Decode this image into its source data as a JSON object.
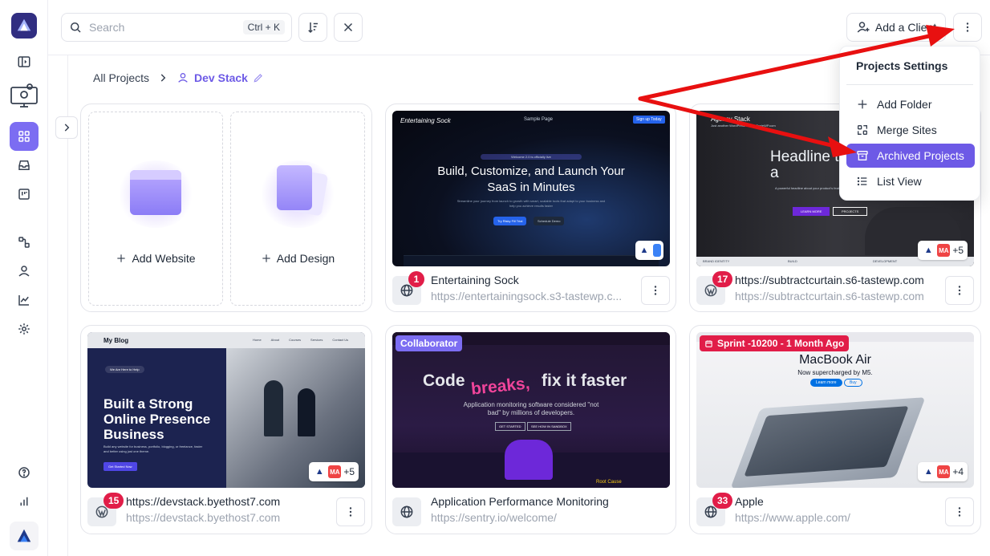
{
  "search": {
    "placeholder": "Search",
    "shortcut": "Ctrl + K"
  },
  "header": {
    "add_client_label": "Add a Client"
  },
  "breadcrumb": {
    "root": "All Projects",
    "current": "Dev Stack"
  },
  "add_cards": [
    {
      "label": "Add Website"
    },
    {
      "label": "Add Design"
    }
  ],
  "projects": [
    {
      "title": "Entertaining Sock",
      "url": "https://entertainingsock.s3-tastewp.c...",
      "count": "1",
      "extra_users": "",
      "shot": {
        "brand": "Entertaining Sock",
        "nav": "Sample Page",
        "cta": "Sign up Today",
        "pill": "Welcome 2.0 is officially live",
        "headline": "Build, Customize, and Launch Your SaaS in Minutes",
        "sub": "Streamline your journey from launch to growth with smart, scalable tools that adapt to your business and help you achieve results faster",
        "primary_btn": "Try Risky Fill Trial",
        "secondary_btn": "Schedule Demo"
      }
    },
    {
      "title": "https://subtractcurtain.s6-tastewp.com",
      "url": "https://subtractcurtain.s6-tastewp.com",
      "count": "17",
      "extra_users": "+5",
      "shot": {
        "brand": "Agency Stack",
        "sub_brand": "Just another WordPress site by TasteWP.com",
        "headline": "Headline t people's a",
        "sub": "A powerful headline about your product's features to your chosen product.",
        "primary_btn": "LEARN MORE",
        "secondary_btn": "PROJECTS",
        "footer": [
          "BRAND IDENTITY",
          "BUILD",
          "DEVELOPMENT"
        ]
      }
    },
    {
      "title": "https://devstack.byethost7.com",
      "url": "https://devstack.byethost7.com",
      "count": "15",
      "extra_users": "+5",
      "shot": {
        "brand": "My Blog",
        "nav": [
          "Home",
          "About",
          "Courses",
          "Services",
          "Contact Us"
        ],
        "pill": "We Are Here to Help",
        "headline": "Built a Strong Online Presence Business",
        "sub": "Build any website for business, portfolio, blogging, or freelance, faster and better using just one theme.",
        "primary_btn": "Get Started Now"
      }
    },
    {
      "title": "Application Performance Monitoring",
      "url": "https://sentry.io/welcome/",
      "count": "",
      "extra_users": "",
      "tag": "Collaborator",
      "shot": {
        "headline_a": "Code",
        "headline_b": "breaks,",
        "headline_c": "fix it faster",
        "sub": "Application monitoring software considered \"not bad\" by millions of developers.",
        "primary_btn": "GET STARTED",
        "secondary_btn": "SEE HOW IN SANDBOX",
        "panel": "Root Cause"
      }
    },
    {
      "title": "Apple",
      "url": "https://www.apple.com/",
      "count": "33",
      "extra_users": "+4",
      "tag": "Sprint -10200 - 1 Month Ago",
      "shot": {
        "headline": "MacBook Air",
        "sub": "Now supercharged by M5.",
        "primary_btn": "Learn more",
        "secondary_btn": "Buy"
      }
    }
  ],
  "menu": {
    "title": "Projects Settings",
    "items": [
      {
        "label": "Add Folder",
        "icon": "plus-icon"
      },
      {
        "label": "Merge Sites",
        "icon": "merge-icon"
      },
      {
        "label": "Archived Projects",
        "icon": "archive-icon"
      },
      {
        "label": "List View",
        "icon": "list-icon"
      }
    ]
  },
  "colors": {
    "accent": "#6d5ae6",
    "badge": "#e11d48",
    "arrow": "#e81010"
  }
}
